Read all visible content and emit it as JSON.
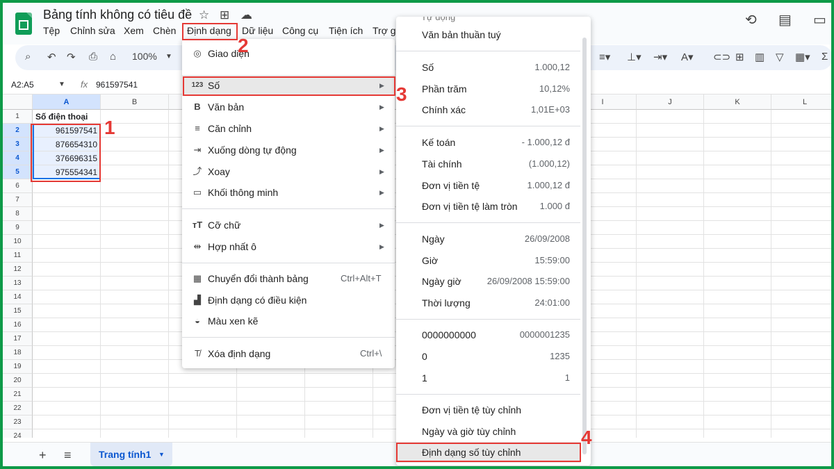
{
  "app": {
    "title": "Bảng tính không có tiêu đề"
  },
  "menubar": [
    "Tệp",
    "Chỉnh sửa",
    "Xem",
    "Chèn",
    "Định dạng",
    "Dữ liệu",
    "Công cụ",
    "Tiện ích",
    "Trợ g"
  ],
  "toolbar": {
    "zoom": "100%"
  },
  "formula_bar": {
    "name_box": "A2:A5",
    "fx": "fx",
    "value": "961597541"
  },
  "columns": [
    "A",
    "B",
    "I",
    "J",
    "K",
    "L"
  ],
  "rows": [
    "1",
    "2",
    "3",
    "4",
    "5",
    "6",
    "7",
    "8",
    "9",
    "10",
    "11",
    "12",
    "13",
    "14",
    "15",
    "16",
    "17",
    "18",
    "19",
    "20",
    "21",
    "22",
    "23",
    "24"
  ],
  "cells": {
    "header": "Số điện thoại",
    "values": [
      "961597541",
      "876654310",
      "376696315",
      "975554341"
    ]
  },
  "format_menu": {
    "items": [
      {
        "label": "Giao diện",
        "icon": "palette-icon",
        "icon_glyph": "◎"
      },
      {
        "label": "Số",
        "icon": "number-format-icon",
        "icon_glyph": "123"
      },
      {
        "label": "Văn bản",
        "icon": "bold-icon",
        "icon_glyph": "B"
      },
      {
        "label": "Căn chỉnh",
        "icon": "align-icon",
        "icon_glyph": "≡"
      },
      {
        "label": "Xuống dòng tự động",
        "icon": "wrap-icon",
        "icon_glyph": "⇥"
      },
      {
        "label": "Xoay",
        "icon": "rotate-icon",
        "icon_glyph": "⤴"
      },
      {
        "label": "Khối thông minh",
        "icon": "smart-chip-icon",
        "icon_glyph": "▭"
      },
      {
        "label": "Cỡ chữ",
        "icon": "font-size-icon",
        "icon_glyph": "тT"
      },
      {
        "label": "Hợp nhất ô",
        "icon": "merge-icon",
        "icon_glyph": "⇹"
      },
      {
        "label": "Chuyển đổi thành bảng",
        "icon": "table-icon",
        "icon_glyph": "▦",
        "shortcut": "Ctrl+Alt+T"
      },
      {
        "label": "Định dạng có điều kiện",
        "icon": "paint-roller-icon",
        "icon_glyph": "▟"
      },
      {
        "label": "Màu xen kẽ",
        "icon": "drop-icon",
        "icon_glyph": "◒"
      },
      {
        "label": "Xóa định dạng",
        "icon": "clear-format-icon",
        "icon_glyph": "T̸",
        "shortcut": "Ctrl+\\"
      }
    ]
  },
  "number_submenu": {
    "top_partial": "Tự động",
    "items": [
      {
        "label": "Văn bản thuần tuý",
        "example": ""
      },
      {
        "label": "Số",
        "example": "1.000,12"
      },
      {
        "label": "Phần trăm",
        "example": "10,12%"
      },
      {
        "label": "Chính xác",
        "example": "1,01E+03"
      },
      {
        "label": "Kế toán",
        "example": "- 1.000,12 đ"
      },
      {
        "label": "Tài chính",
        "example": "(1.000,12)"
      },
      {
        "label": "Đơn vị tiền tệ",
        "example": "1.000,12 đ"
      },
      {
        "label": "Đơn vị tiền tệ làm tròn",
        "example": "1.000 đ"
      },
      {
        "label": "Ngày",
        "example": "26/09/2008"
      },
      {
        "label": "Giờ",
        "example": "15:59:00"
      },
      {
        "label": "Ngày giờ",
        "example": "26/09/2008 15:59:00"
      },
      {
        "label": "Thời lượng",
        "example": "24:01:00"
      },
      {
        "label": "0000000000",
        "example": "0000001235"
      },
      {
        "label": "0",
        "example": "1235"
      },
      {
        "label": "1",
        "example": "1"
      },
      {
        "label": "Đơn vị tiền tệ tùy chỉnh",
        "example": ""
      },
      {
        "label": "Ngày và giờ tùy chỉnh",
        "example": ""
      },
      {
        "label": "Định dạng số tùy chỉnh",
        "example": ""
      }
    ]
  },
  "annotations": [
    "1",
    "2",
    "3",
    "4"
  ],
  "sheet_tab": {
    "name": "Trang tính1"
  },
  "colors": {
    "accent": "#0b57d0",
    "annotation": "#e53935",
    "border": "#0e9a48"
  }
}
